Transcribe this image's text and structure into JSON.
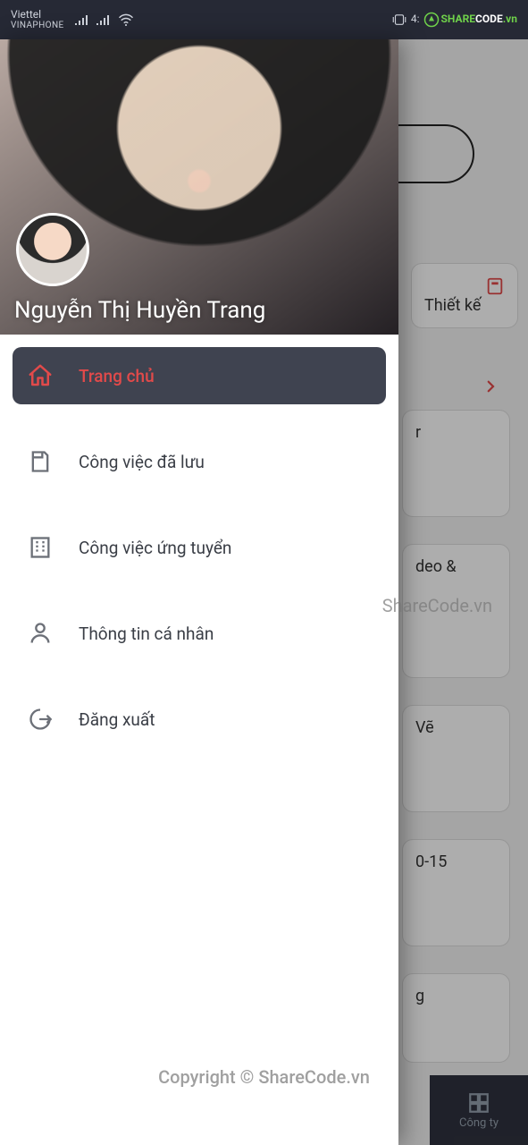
{
  "status": {
    "carrier1": "Viettel",
    "carrier2": "VINAPHONE",
    "time": "4:"
  },
  "logo": {
    "part1": "SHARE",
    "part2": "CODE",
    "part3": ".vn"
  },
  "user": {
    "name": "Nguyễn Thị Huyền Trang"
  },
  "menu": {
    "home": "Trang chủ",
    "saved": "Công việc đã lưu",
    "applied": "Công việc ứng tuyển",
    "profile": "Thông tin cá nhân",
    "logout": "Đăng xuất"
  },
  "background": {
    "category1": "Thiết kế",
    "job1_snip": "r",
    "job2_snip": "deo &",
    "job3_snip": "Vẽ",
    "job4_snip": "0-15",
    "job5_snip": "g"
  },
  "bottom_nav": {
    "company": "Công ty"
  },
  "watermark": {
    "mid": "ShareCode.vn",
    "bot": "Copyright © ShareCode.vn"
  }
}
